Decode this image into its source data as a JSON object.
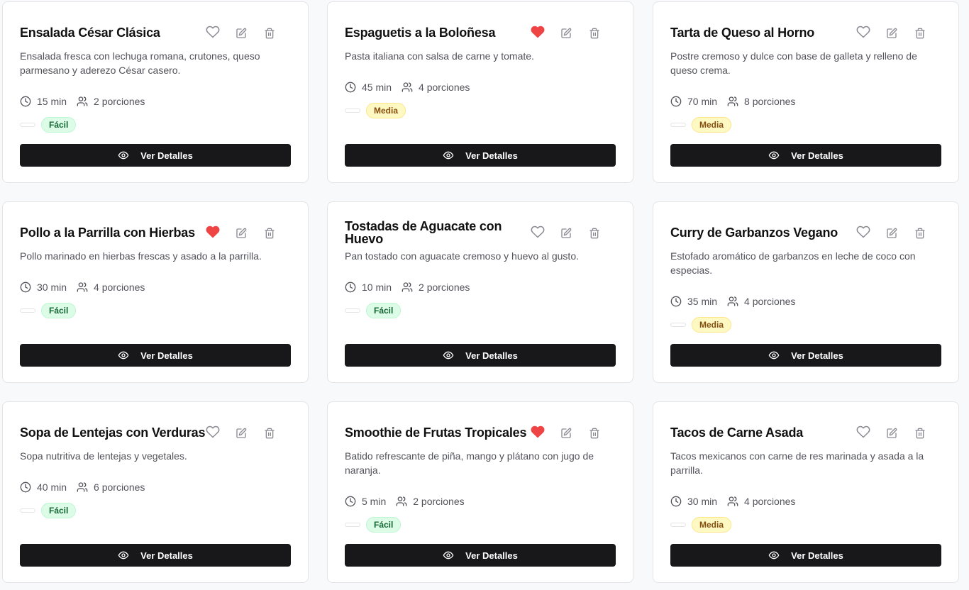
{
  "recipes": [
    {
      "title": "Ensalada César Clásica",
      "description": "Ensalada fresca con lechuga romana, crutones, queso parmesano y aderezo César casero.",
      "time": "15 min",
      "servings": "2 porciones",
      "difficulty": "Fácil",
      "favorite": false,
      "button": "Ver Detalles"
    },
    {
      "title": "Espaguetis a la Boloñesa",
      "description": "Pasta italiana con salsa de carne y tomate.",
      "time": "45 min",
      "servings": "4 porciones",
      "difficulty": "Media",
      "favorite": true,
      "button": "Ver Detalles"
    },
    {
      "title": "Tarta de Queso al Horno",
      "description": "Postre cremoso y dulce con base de galleta y relleno de queso crema.",
      "time": "70 min",
      "servings": "8 porciones",
      "difficulty": "Media",
      "favorite": false,
      "button": "Ver Detalles"
    },
    {
      "title": "Pollo a la Parrilla con Hierbas",
      "description": "Pollo marinado en hierbas frescas y asado a la parrilla.",
      "time": "30 min",
      "servings": "4 porciones",
      "difficulty": "Fácil",
      "favorite": true,
      "button": "Ver Detalles"
    },
    {
      "title": "Tostadas de Aguacate con Huevo",
      "description": "Pan tostado con aguacate cremoso y huevo al gusto.",
      "time": "10 min",
      "servings": "2 porciones",
      "difficulty": "Fácil",
      "favorite": false,
      "button": "Ver Detalles"
    },
    {
      "title": "Curry de Garbanzos Vegano",
      "description": "Estofado aromático de garbanzos en leche de coco con especias.",
      "time": "35 min",
      "servings": "4 porciones",
      "difficulty": "Media",
      "favorite": false,
      "button": "Ver Detalles"
    },
    {
      "title": "Sopa de Lentejas con Verduras",
      "description": "Sopa nutritiva de lentejas y vegetales.",
      "time": "40 min",
      "servings": "6 porciones",
      "difficulty": "Fácil",
      "favorite": false,
      "button": "Ver Detalles"
    },
    {
      "title": "Smoothie de Frutas Tropicales",
      "description": "Batido refrescante de piña, mango y plátano con jugo de naranja.",
      "time": "5 min",
      "servings": "2 porciones",
      "difficulty": "Fácil",
      "favorite": true,
      "button": "Ver Detalles"
    },
    {
      "title": "Tacos de Carne Asada",
      "description": "Tacos mexicanos con carne de res marinada y asada a la parrilla.",
      "time": "30 min",
      "servings": "4 porciones",
      "difficulty": "Media",
      "favorite": false,
      "button": "Ver Detalles"
    }
  ],
  "icons": {
    "favorite": "heart-icon",
    "edit": "edit-icon",
    "delete": "trash-icon",
    "time": "clock-icon",
    "servings": "users-icon",
    "view": "eye-icon"
  },
  "colors": {
    "favorite_active": "#ef4444",
    "button_bg": "#18181b",
    "easy_bg": "#dcfce7",
    "easy_text": "#166534",
    "medium_bg": "#fef9c3",
    "medium_text": "#854d0e"
  }
}
